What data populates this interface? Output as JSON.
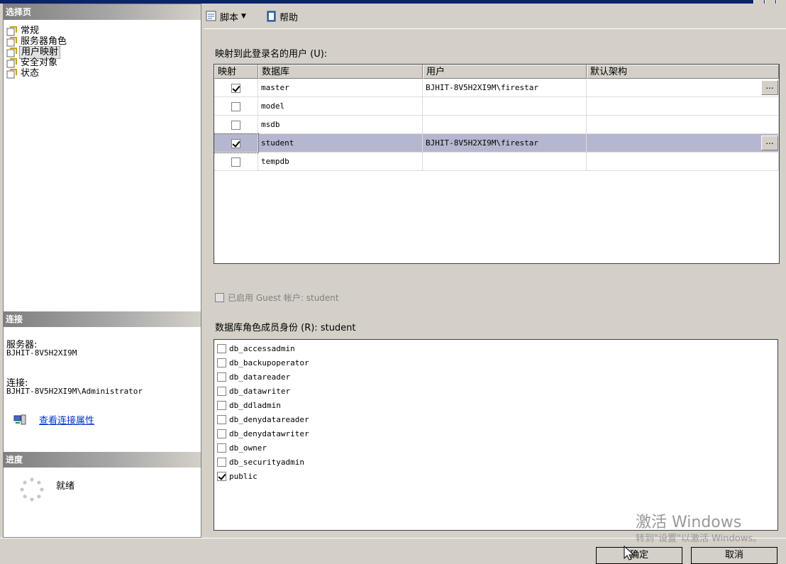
{
  "left": {
    "select_page_header": "选择页",
    "pages": [
      {
        "label": "常规",
        "selected": false
      },
      {
        "label": "服务器角色",
        "selected": false
      },
      {
        "label": "用户映射",
        "selected": true
      },
      {
        "label": "安全对象",
        "selected": false
      },
      {
        "label": "状态",
        "selected": false
      }
    ],
    "connection_header": "连接",
    "server_label": "服务器:",
    "server_value": "BJHIT-8V5H2XI9M",
    "connection_label": "连接:",
    "connection_value": "BJHIT-8V5H2XI9M\\Administrator",
    "view_props_link": "查看连接属性",
    "progress_header": "进度",
    "progress_status": "就绪"
  },
  "toolbar": {
    "script_label": "脚本",
    "help_label": "帮助"
  },
  "mapping": {
    "section_label": "映射到此登录名的用户 (U):",
    "columns": [
      "映射",
      "数据库",
      "用户",
      "默认架构"
    ],
    "rows": [
      {
        "mapped": true,
        "database": "master",
        "user": "BJHIT-8V5H2XI9M\\firestar",
        "schema": "",
        "ellipsis": "..."
      },
      {
        "mapped": false,
        "database": "model",
        "user": "",
        "schema": "",
        "ellipsis": ""
      },
      {
        "mapped": false,
        "database": "msdb",
        "user": "",
        "schema": "",
        "ellipsis": ""
      },
      {
        "mapped": true,
        "database": "student",
        "user": "BJHIT-8V5H2XI9M\\firestar",
        "schema": "",
        "ellipsis": "...",
        "selected": true
      },
      {
        "mapped": false,
        "database": "tempdb",
        "user": "",
        "schema": "",
        "ellipsis": ""
      }
    ]
  },
  "guest": {
    "label": "已启用 Guest 帐户: student",
    "checked": false
  },
  "roles": {
    "section_label": "数据库角色成员身份 (R): student",
    "items": [
      {
        "name": "db_accessadmin",
        "checked": false
      },
      {
        "name": "db_backupoperator",
        "checked": false
      },
      {
        "name": "db_datareader",
        "checked": false
      },
      {
        "name": "db_datawriter",
        "checked": false
      },
      {
        "name": "db_ddladmin",
        "checked": false
      },
      {
        "name": "db_denydatareader",
        "checked": false
      },
      {
        "name": "db_denydatawriter",
        "checked": false
      },
      {
        "name": "db_owner",
        "checked": false
      },
      {
        "name": "db_securityadmin",
        "checked": false
      },
      {
        "name": "public",
        "checked": true
      }
    ]
  },
  "buttons": {
    "ok": "确定",
    "cancel": "取消"
  },
  "watermark": {
    "line1": "激活 Windows",
    "line2": "转到\"设置\"以激活 Windows。"
  }
}
